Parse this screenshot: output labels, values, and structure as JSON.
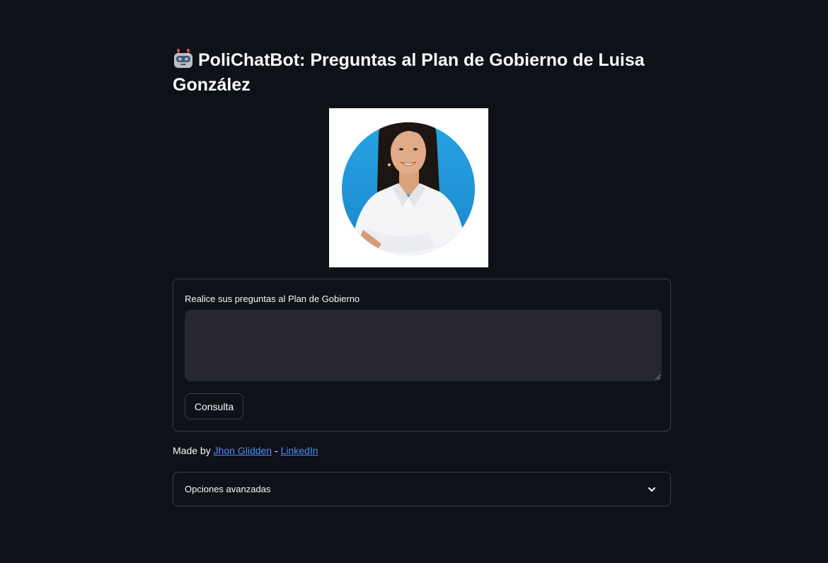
{
  "page": {
    "title": "PoliChatBot: Preguntas al Plan de Gobierno de Luisa González",
    "title_icon": "robot-icon"
  },
  "portrait": {
    "alt": "Luisa González",
    "circle_color": "#1d9ad9"
  },
  "form": {
    "question_label": "Realice sus preguntas al Plan de Gobierno",
    "question_value": "",
    "submit_label": "Consulta"
  },
  "credits": {
    "prefix": "Made by ",
    "author_link": "Jhon Glidden",
    "separator": " - ",
    "linkedin_link": "LinkedIn"
  },
  "advanced": {
    "label": "Opciones avanzadas",
    "icon": "chevron-down-icon"
  },
  "colors": {
    "background": "#0e1117",
    "input_background": "#262730",
    "border": "#3d3f47",
    "link": "#4f8bf9",
    "text": "#fafafa"
  }
}
